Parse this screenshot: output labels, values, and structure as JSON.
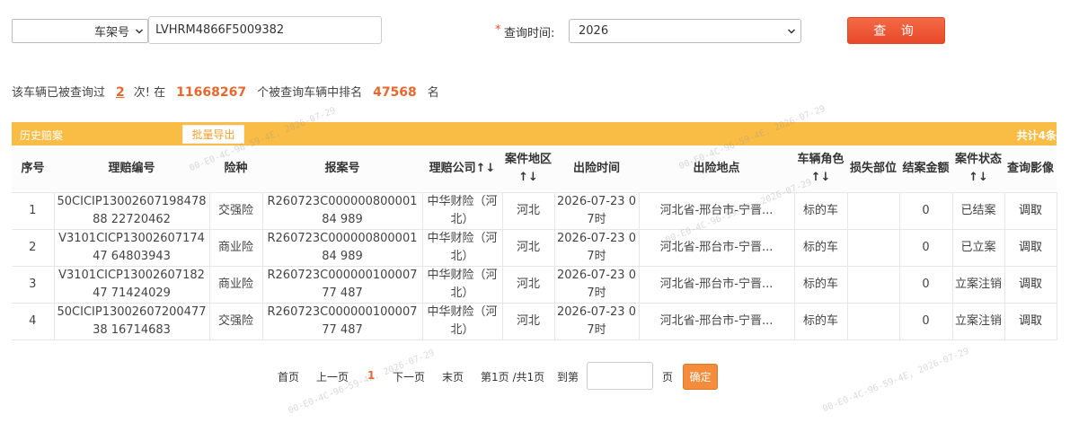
{
  "search": {
    "type_select": "车架号",
    "vin_value": "LVHRM4866F5009382",
    "required_mark": "*",
    "time_label": "查询时间:",
    "year_select": "2026",
    "query_label": "查 询"
  },
  "stats": {
    "text_a": "该车辆已被查询过",
    "count": "2",
    "text_b": "次! 在",
    "total_vehicles": "11668267",
    "text_c": "个被查询车辆中排名",
    "rank": "47568",
    "text_d": "名"
  },
  "panel": {
    "title": "历史赔案",
    "export_label": "批量导出",
    "total": "共计4条"
  },
  "table": {
    "headers": [
      "序号",
      "理赔编号",
      "险种",
      "报案号",
      "理赔公司↑↓",
      "案件地区↑↓",
      "出险时间",
      "出险地点",
      "车辆角色↑↓",
      "损失部位",
      "结案金额",
      "案件状态↑↓",
      "查询影像"
    ],
    "rows": [
      [
        "1",
        "50CICIP1300260719847888 22720462",
        "交强险",
        "R260723C00000080000184 989",
        "中华财险（河北）",
        "河北",
        "2026-07-23 07时",
        "河北省-邢台市-宁晋...",
        "标的车",
        "",
        "0",
        "已结案",
        "调取"
      ],
      [
        "2",
        "V3101CICP1300260717447 64803943",
        "商业险",
        "R260723C00000080000184 989",
        "中华财险（河北）",
        "河北",
        "2026-07-23 07时",
        "河北省-邢台市-宁晋...",
        "标的车",
        "",
        "0",
        "已立案",
        "调取"
      ],
      [
        "3",
        "V3101CICP1300260718247 71424029",
        "商业险",
        "R260723C00000010000777 487",
        "中华财险（河北）",
        "河北",
        "2026-07-23 07时",
        "河北省-邢台市-宁晋...",
        "标的车",
        "",
        "0",
        "立案注销",
        "调取"
      ],
      [
        "4",
        "50CICIP1300260720047738 16714683",
        "交强险",
        "R260723C00000010000777 487",
        "中华财险（河北）",
        "河北",
        "2026-07-23 07时",
        "河北省-邢台市-宁晋...",
        "标的车",
        "",
        "0",
        "立案注销",
        "调取"
      ]
    ]
  },
  "pager": {
    "first": "首页",
    "prev": "上一页",
    "current": "1",
    "next": "下一页",
    "last": "末页",
    "info": "第1页 /共1页",
    "goto_label": "到第",
    "page_unit": "页",
    "ok_label": "确定"
  },
  "watermark": "00-E0-4C-96-59-4E, 2026-07-29",
  "colors": {
    "accent_orange": "#f9bd45",
    "query_red": "#e8492a",
    "highlight": "#e8672e"
  }
}
